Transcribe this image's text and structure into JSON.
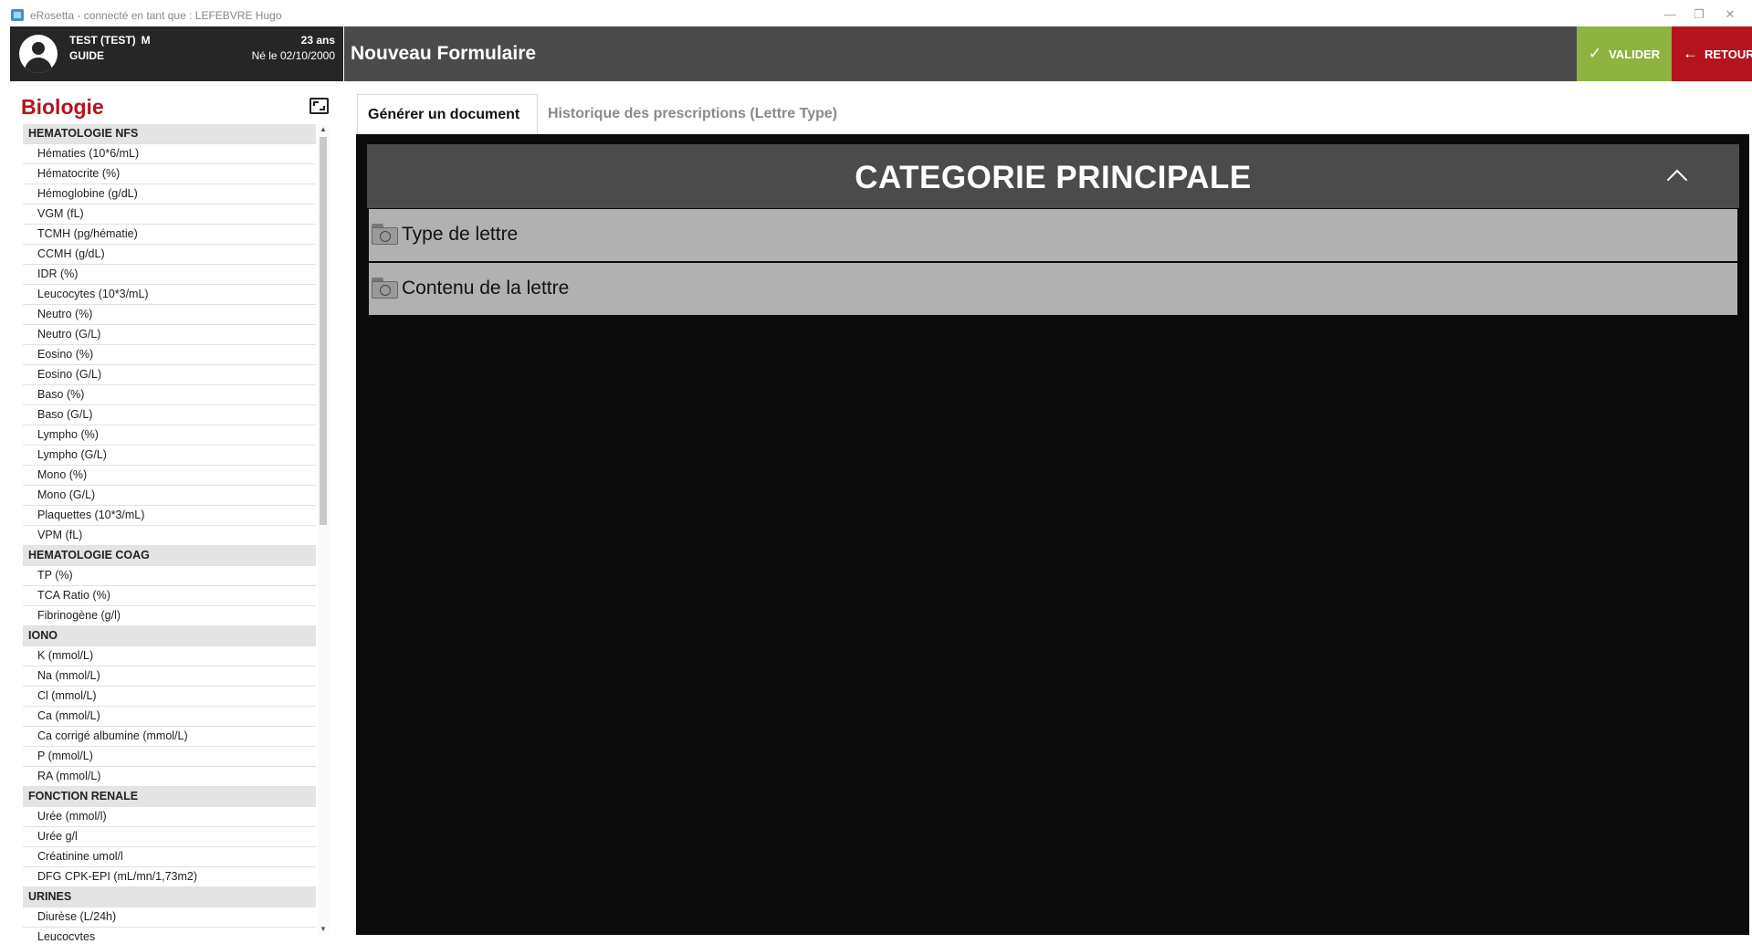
{
  "window": {
    "title": "eRosetta - connecté en tant que : LEFEBVRE Hugo",
    "minimize": "—",
    "restore": "❐",
    "close": "✕"
  },
  "patient": {
    "name": "TEST (TEST)",
    "sex": "M",
    "guide": "GUIDE",
    "age": "23 ans",
    "birth": "Né le 02/10/2000"
  },
  "header": {
    "title": "Nouveau Formulaire",
    "valider_icon": "✓",
    "valider_label": "VALIDER",
    "retour_icon": "←",
    "retour_label": "RETOUR"
  },
  "sidebar": {
    "heading": "Biologie",
    "rows": [
      {
        "type": "cat",
        "label": "HEMATOLOGIE NFS"
      },
      {
        "type": "item",
        "label": "Hématies (10*6/mL)"
      },
      {
        "type": "item",
        "label": "Hématocrite (%)"
      },
      {
        "type": "item",
        "label": "Hémoglobine (g/dL)"
      },
      {
        "type": "item",
        "label": "VGM (fL)"
      },
      {
        "type": "item",
        "label": "TCMH (pg/hématie)"
      },
      {
        "type": "item",
        "label": "CCMH (g/dL)"
      },
      {
        "type": "item",
        "label": "IDR (%)"
      },
      {
        "type": "item",
        "label": "Leucocytes (10*3/mL)"
      },
      {
        "type": "item",
        "label": "Neutro (%)"
      },
      {
        "type": "item",
        "label": "Neutro (G/L)"
      },
      {
        "type": "item",
        "label": "Eosino (%)"
      },
      {
        "type": "item",
        "label": "Eosino (G/L)"
      },
      {
        "type": "item",
        "label": "Baso (%)"
      },
      {
        "type": "item",
        "label": "Baso (G/L)"
      },
      {
        "type": "item",
        "label": "Lympho (%)"
      },
      {
        "type": "item",
        "label": "Lympho (G/L)"
      },
      {
        "type": "item",
        "label": "Mono (%)"
      },
      {
        "type": "item",
        "label": "Mono (G/L)"
      },
      {
        "type": "item",
        "label": "Plaquettes (10*3/mL)"
      },
      {
        "type": "item",
        "label": "VPM (fL)"
      },
      {
        "type": "cat",
        "label": "HEMATOLOGIE COAG"
      },
      {
        "type": "item",
        "label": "TP (%)"
      },
      {
        "type": "item",
        "label": "TCA Ratio (%)"
      },
      {
        "type": "item",
        "label": "Fibrinogène (g/l)"
      },
      {
        "type": "cat",
        "label": "IONO"
      },
      {
        "type": "item",
        "label": "K (mmol/L)"
      },
      {
        "type": "item",
        "label": "Na (mmol/L)"
      },
      {
        "type": "item",
        "label": "Cl (mmol/L)"
      },
      {
        "type": "item",
        "label": "Ca (mmol/L)"
      },
      {
        "type": "item",
        "label": "Ca corrigé albumine (mmol/L)"
      },
      {
        "type": "item",
        "label": "P (mmol/L)"
      },
      {
        "type": "item",
        "label": "RA (mmol/L)"
      },
      {
        "type": "cat",
        "label": "FONCTION RENALE"
      },
      {
        "type": "item",
        "label": "Urée (mmol/l)"
      },
      {
        "type": "item",
        "label": "Urée g/l"
      },
      {
        "type": "item",
        "label": "Créatinine umol/l"
      },
      {
        "type": "item",
        "label": "DFG CPK-EPI (mL/mn/1,73m2)"
      },
      {
        "type": "cat",
        "label": "URINES"
      },
      {
        "type": "item",
        "label": "Diurèse (L/24h)"
      },
      {
        "type": "item",
        "label": "Leucocytes"
      }
    ]
  },
  "tabs": [
    {
      "label": "Générer un document",
      "active": true
    },
    {
      "label": "Historique des prescriptions (Lettre Type)",
      "active": false
    }
  ],
  "main": {
    "category_title": "CATEGORIE PRINCIPALE",
    "sections": [
      {
        "label": "Type de lettre"
      },
      {
        "label": "Contenu de la lettre"
      }
    ]
  },
  "icons": {
    "avatar": "user-avatar-icon",
    "expand": "expand-icon",
    "collapse": "chevron-up-icon",
    "section": "folder-icon"
  },
  "colors": {
    "accent_red": "#b3141e",
    "valider_green": "#8fb340",
    "header_dark": "#4a4a4a",
    "patient_bg": "#262626",
    "content_bg": "#0b0b0b",
    "section_bg": "#b1b1b1"
  }
}
